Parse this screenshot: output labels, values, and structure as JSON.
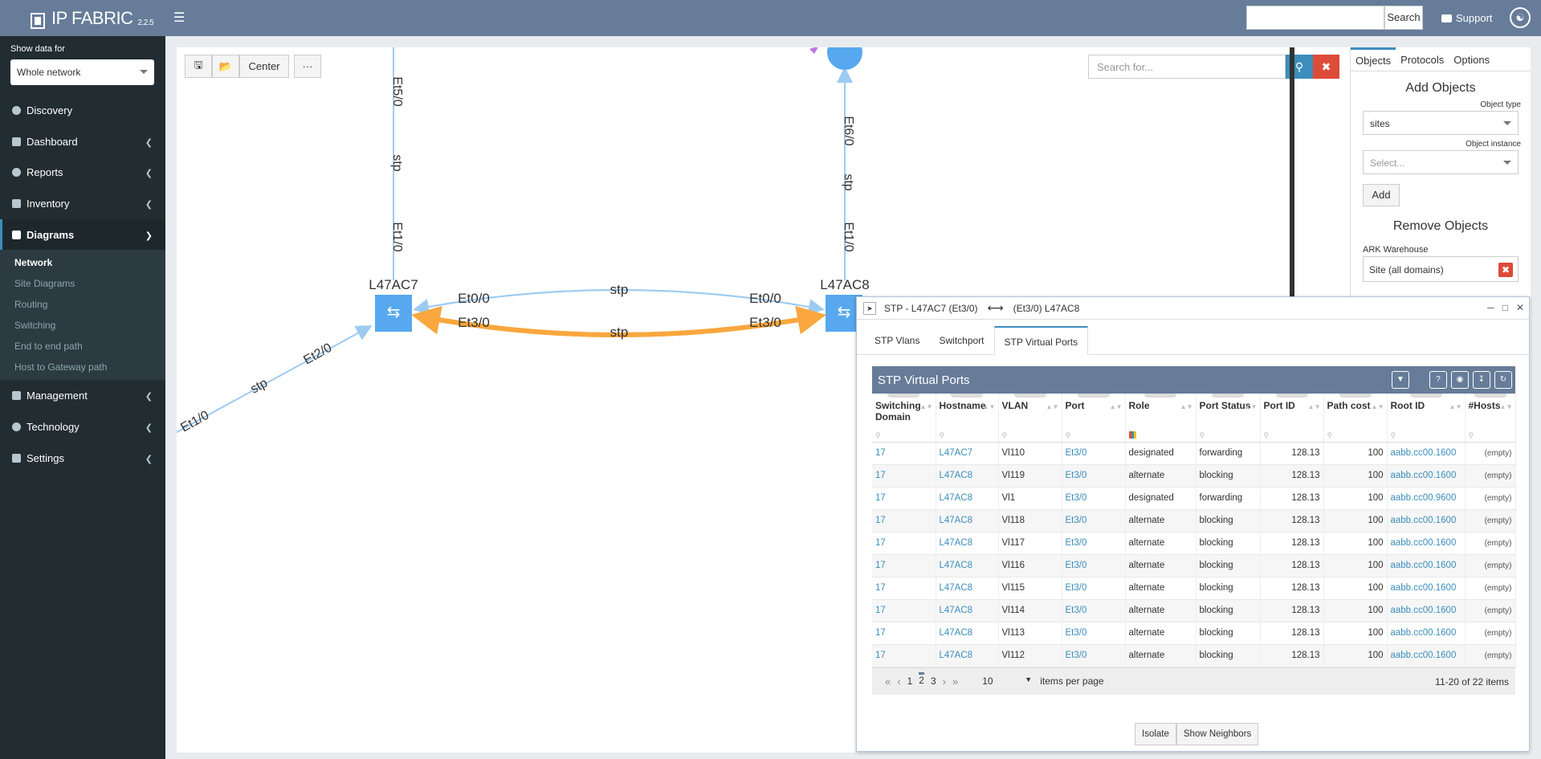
{
  "app": {
    "brand": "IP FABRIC",
    "version": "2.2.5"
  },
  "topbar": {
    "search_label": "Search",
    "support_label": "Support"
  },
  "sidebar": {
    "show_label": "Show data for",
    "scope_value": "Whole network",
    "items": [
      {
        "label": "Discovery"
      },
      {
        "label": "Dashboard"
      },
      {
        "label": "Reports"
      },
      {
        "label": "Inventory"
      },
      {
        "label": "Diagrams"
      },
      {
        "label": "Management"
      },
      {
        "label": "Technology"
      },
      {
        "label": "Settings"
      }
    ],
    "diagrams_sub": [
      "Network",
      "Site Diagrams",
      "Routing",
      "Switching",
      "End to end path",
      "Host to Gateway path"
    ]
  },
  "toolbar": {
    "center_label": "Center",
    "more_label": "···"
  },
  "canvas_search": {
    "placeholder": "Search for..."
  },
  "diagram": {
    "left_switch": "L47AC7",
    "right_switch": "L47AC8",
    "labels": [
      "Et5/0",
      "stp",
      "Et1/0",
      "Et6/0",
      "stp",
      "Et1/0",
      "Et0/0",
      "stp",
      "Et0/0",
      "Et3/0",
      "stp",
      "Et3/0",
      "Et2/0",
      "stp",
      "Et1/0"
    ]
  },
  "right_panel": {
    "tabs": [
      "Objects",
      "Protocols",
      "Options"
    ],
    "add_title": "Add Objects",
    "object_type_label": "Object type",
    "object_type_value": "sites",
    "object_instance_label": "Object instance",
    "object_instance_placeholder": "Select...",
    "add_label": "Add",
    "remove_title": "Remove Objects",
    "site_group": "ARK Warehouse",
    "site_item": "Site (all domains)"
  },
  "dialog": {
    "title_left": "STP - L47AC7 (Et3/0)",
    "title_arrow": "⟷",
    "title_right": "(Et3/0) L47AC8",
    "tabs": [
      "STP Vlans",
      "Switchport",
      "STP Virtual Ports"
    ],
    "grid_title": "STP Virtual Ports",
    "columns": [
      "Switching Domain",
      "Hostname",
      "VLAN",
      "Port",
      "Role",
      "Port Status",
      "Port ID",
      "Path cost",
      "Root ID",
      "#Hosts"
    ],
    "rows": [
      [
        "17",
        "L47AC7",
        "Vl110",
        "Et3/0",
        "designated",
        "forwarding",
        "128.13",
        "100",
        "aabb.cc00.1600",
        "(empty)"
      ],
      [
        "17",
        "L47AC8",
        "Vl119",
        "Et3/0",
        "alternate",
        "blocking",
        "128.13",
        "100",
        "aabb.cc00.1600",
        "(empty)"
      ],
      [
        "17",
        "L47AC8",
        "Vl1",
        "Et3/0",
        "designated",
        "forwarding",
        "128.13",
        "100",
        "aabb.cc00.9600",
        "(empty)"
      ],
      [
        "17",
        "L47AC8",
        "Vl118",
        "Et3/0",
        "alternate",
        "blocking",
        "128.13",
        "100",
        "aabb.cc00.1600",
        "(empty)"
      ],
      [
        "17",
        "L47AC8",
        "Vl117",
        "Et3/0",
        "alternate",
        "blocking",
        "128.13",
        "100",
        "aabb.cc00.1600",
        "(empty)"
      ],
      [
        "17",
        "L47AC8",
        "Vl116",
        "Et3/0",
        "alternate",
        "blocking",
        "128.13",
        "100",
        "aabb.cc00.1600",
        "(empty)"
      ],
      [
        "17",
        "L47AC8",
        "Vl115",
        "Et3/0",
        "alternate",
        "blocking",
        "128.13",
        "100",
        "aabb.cc00.1600",
        "(empty)"
      ],
      [
        "17",
        "L47AC8",
        "Vl114",
        "Et3/0",
        "alternate",
        "blocking",
        "128.13",
        "100",
        "aabb.cc00.1600",
        "(empty)"
      ],
      [
        "17",
        "L47AC8",
        "Vl113",
        "Et3/0",
        "alternate",
        "blocking",
        "128.13",
        "100",
        "aabb.cc00.1600",
        "(empty)"
      ],
      [
        "17",
        "L47AC8",
        "Vl112",
        "Et3/0",
        "alternate",
        "blocking",
        "128.13",
        "100",
        "aabb.cc00.1600",
        "(empty)"
      ]
    ],
    "pager": {
      "pages": [
        "1",
        "2",
        "3"
      ],
      "current": "2",
      "per_page": "10",
      "per_page_label": "items per page",
      "info": "11-20 of 22 items"
    },
    "buttons": {
      "isolate": "Isolate",
      "neighbors": "Show Neighbors"
    }
  },
  "colors": {
    "header": "#667c99",
    "sidebar": "#222d32",
    "accent": "#3c8dbc",
    "blocked_link": "#f9a73e",
    "link": "#9ccbf2",
    "switch": "#57a8ee"
  }
}
